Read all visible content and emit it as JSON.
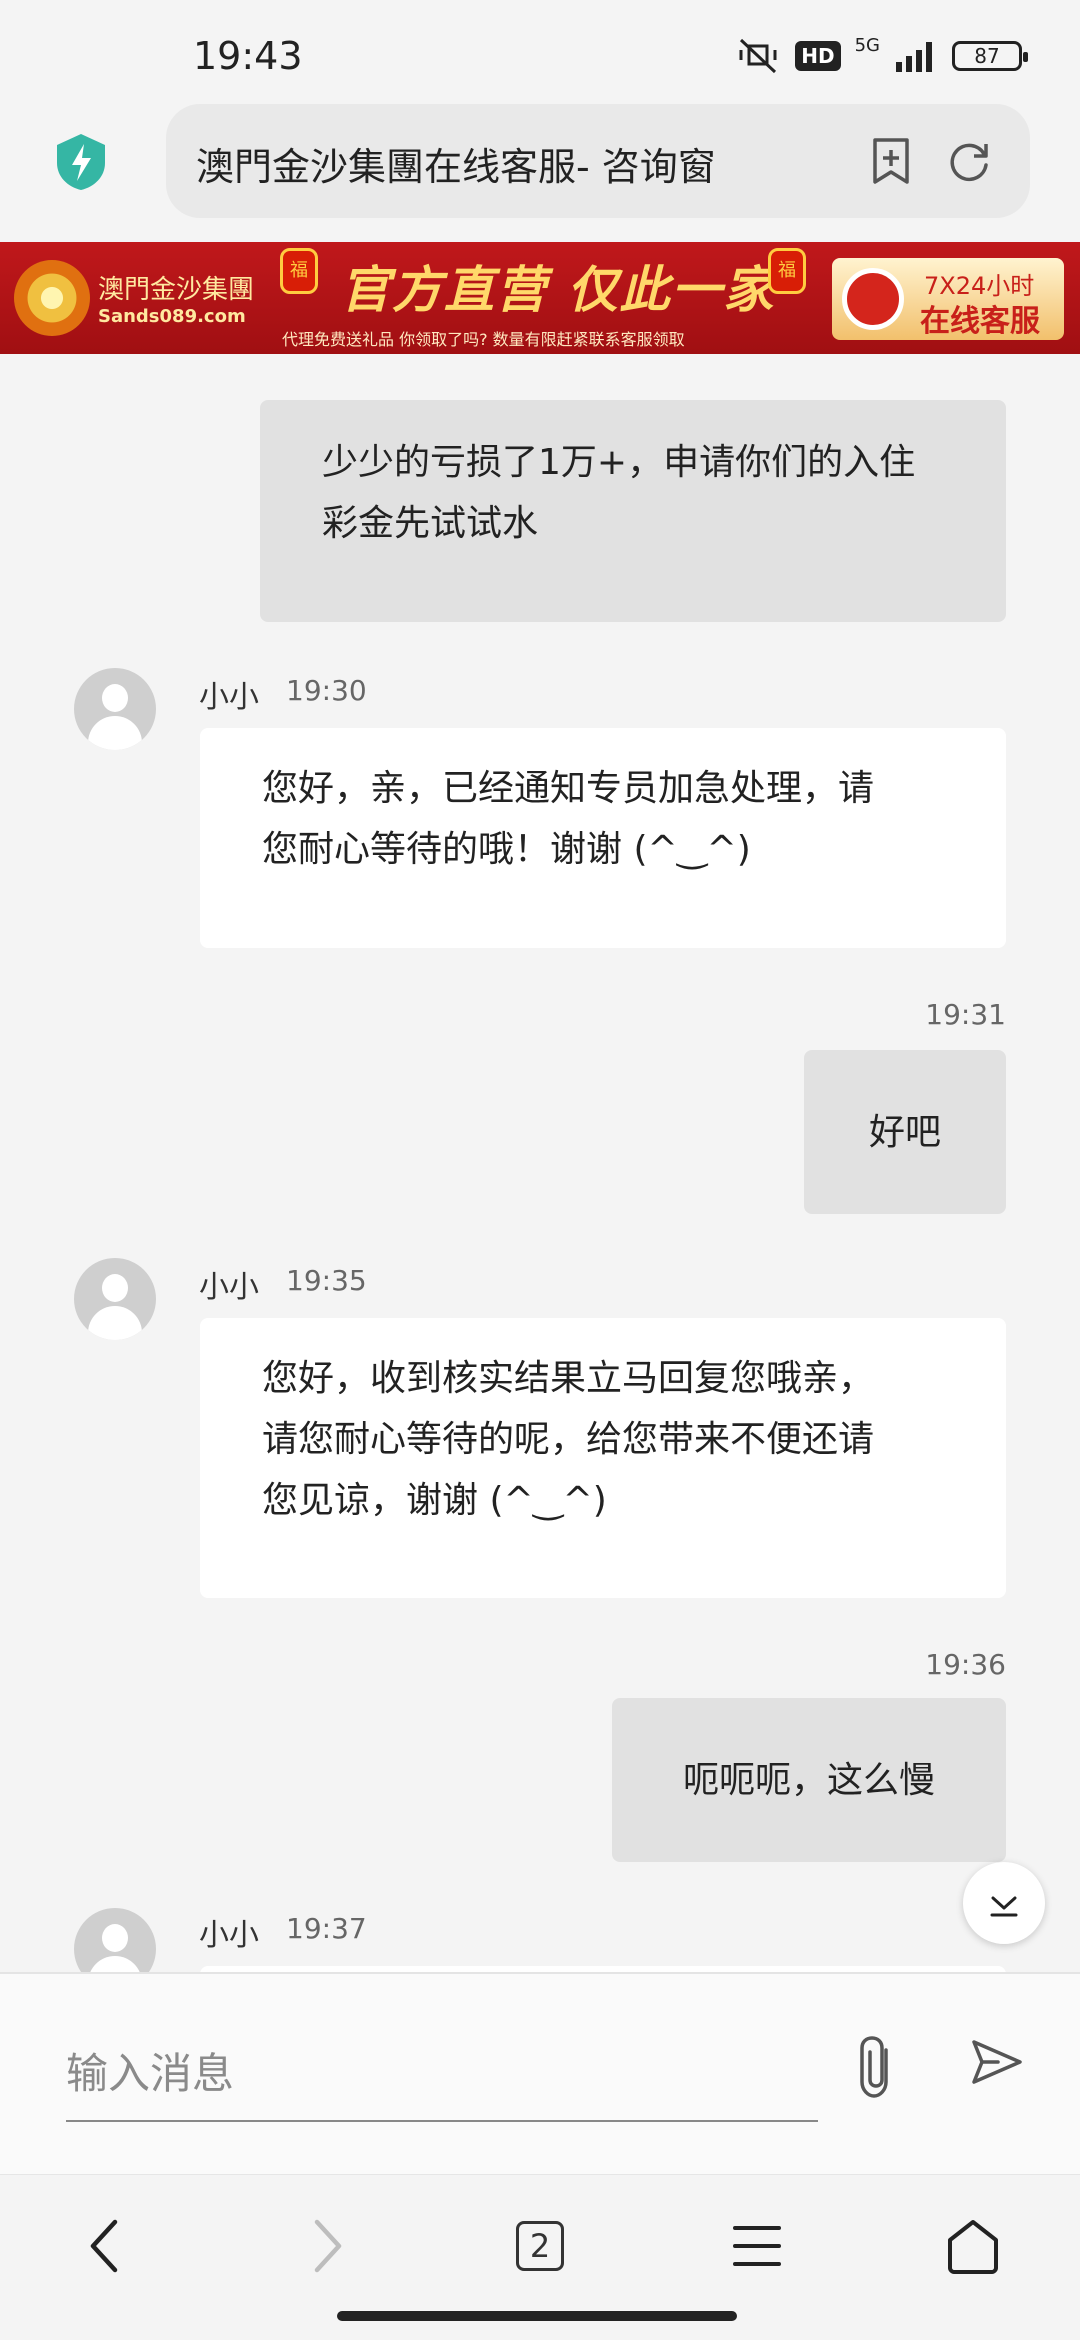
{
  "status_bar": {
    "time": "19:43",
    "hd_label": "HD",
    "network": "5G",
    "battery": "87"
  },
  "browser": {
    "url_title": "澳門金沙集團在线客服- 咨询窗",
    "tab_count": "2"
  },
  "banner": {
    "logo_title": "澳門金沙集團",
    "logo_sub": "Sands089.com",
    "headline": "官方直营 仅此一家",
    "sub_text": "代理免费送礼品 你领取了吗? 数量有限赶紧联系客服领取",
    "lantern_char": "福",
    "service_line1": "7X24小时",
    "service_line2": "在线客服",
    "colors": {
      "bg": "#b8161a",
      "gold": "#ffd86a"
    }
  },
  "chat": {
    "messages": [
      {
        "side": "self",
        "time": "",
        "text_lines": [
          "少少的亏损了1万+，申请你们的入住",
          "彩金先试试水"
        ]
      },
      {
        "side": "agent",
        "name": "小小",
        "time": "19:30",
        "text_lines": [
          "您好，亲，已经通知专员加急处理，请",
          "您耐心等待的哦！谢谢 (^‿^)"
        ]
      },
      {
        "side": "self",
        "time": "19:31",
        "text_lines": [
          "好吧"
        ]
      },
      {
        "side": "agent",
        "name": "小小",
        "time": "19:35",
        "text_lines": [
          "您好，收到核实结果立马回复您哦亲，",
          "请您耐心等待的呢，给您带来不便还请",
          "您见谅，谢谢 (^‿^)"
        ]
      },
      {
        "side": "self",
        "time": "19:36",
        "text_lines": [
          "呃呃呃，这么慢"
        ]
      },
      {
        "side": "agent",
        "name": "小小",
        "time": "19:37",
        "text_lines": []
      }
    ]
  },
  "input": {
    "placeholder": "输入消息"
  }
}
